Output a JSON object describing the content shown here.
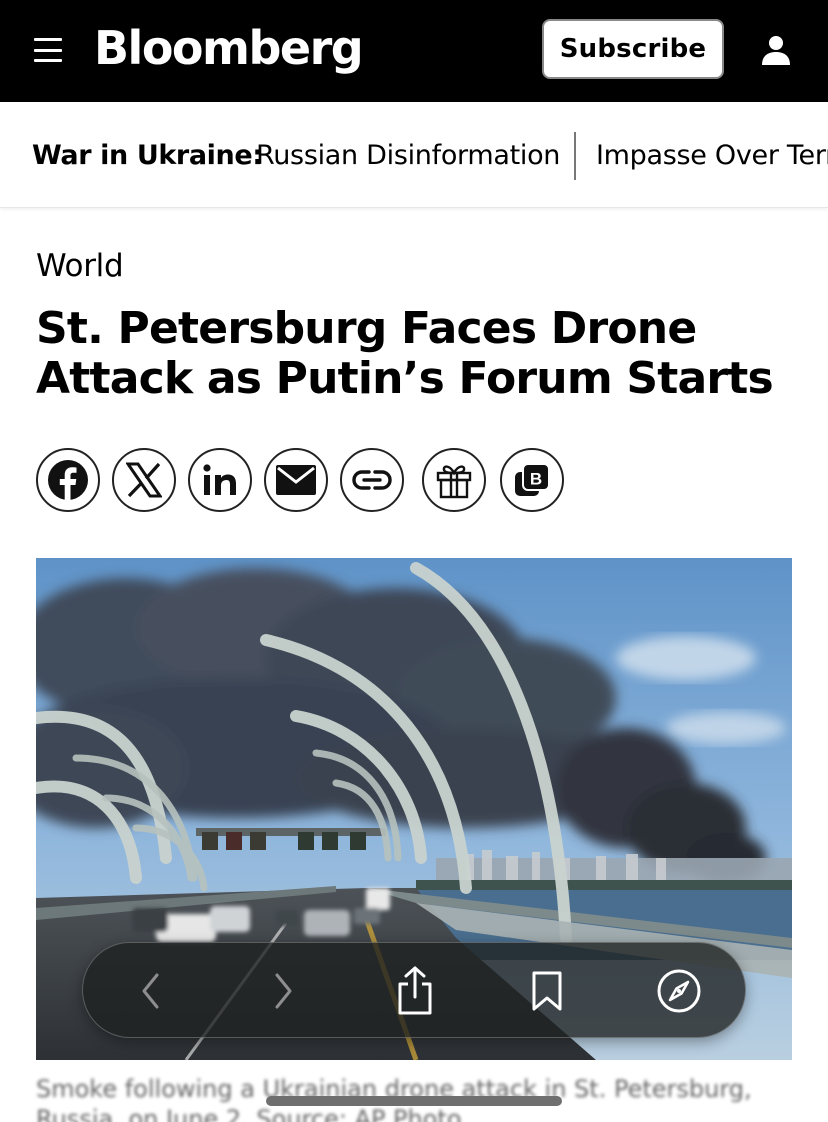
{
  "header": {
    "logo": "Bloomberg",
    "subscribe_label": "Subscribe",
    "background": "#000000"
  },
  "subnav": {
    "label": "War in Ukraine:",
    "links": [
      "Russian Disinformation",
      "Impasse Over Terr"
    ]
  },
  "article": {
    "section": "World",
    "headline": "St. Petersburg Faces Drone Attack as Putin’s Forum Starts",
    "caption": "Smoke following a Ukrainian drone attack in St. Petersburg, Russia, on June 2. Source: AP Photo"
  },
  "share": {
    "items": [
      "facebook-icon",
      "x-icon",
      "linkedin-icon",
      "email-icon",
      "link-icon",
      "gift-icon",
      "bloomberg-b-icon"
    ]
  },
  "safari": {
    "items": [
      "back-icon",
      "forward-icon",
      "share-icon",
      "bookmarks-icon",
      "compass-icon"
    ]
  }
}
